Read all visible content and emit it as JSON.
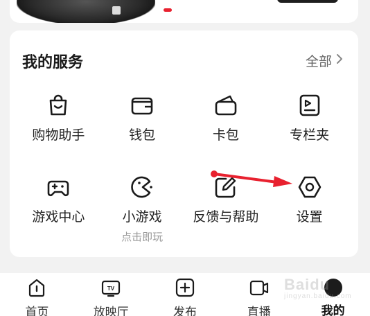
{
  "services": {
    "title": "我的服务",
    "all_label": "全部",
    "items": [
      {
        "label": "购物助手",
        "icon": "shopping-bag-icon"
      },
      {
        "label": "钱包",
        "icon": "wallet-icon"
      },
      {
        "label": "卡包",
        "icon": "card-holder-icon"
      },
      {
        "label": "专栏夹",
        "icon": "column-folder-icon"
      },
      {
        "label": "游戏中心",
        "icon": "gamepad-icon"
      },
      {
        "label": "小游戏",
        "sub": "点击即玩",
        "icon": "mini-game-icon"
      },
      {
        "label": "反馈与帮助",
        "icon": "feedback-edit-icon"
      },
      {
        "label": "设置",
        "icon": "settings-hexagon-icon"
      }
    ]
  },
  "annotation": {
    "color": "#e8212f"
  },
  "tabbar": {
    "items": [
      {
        "label": "首页",
        "icon": "home-icon"
      },
      {
        "label": "放映厅",
        "icon": "tv-icon"
      },
      {
        "label": "发布",
        "icon": "plus-icon"
      },
      {
        "label": "直播",
        "icon": "camera-icon"
      },
      {
        "label": "我的",
        "icon": "avatar-icon",
        "active": true
      }
    ]
  },
  "watermark": {
    "text": "Baidu",
    "sub": "jingyan.baidu.com"
  },
  "colors": {
    "accent": "#e8212f",
    "background": "#f2f2f2",
    "card": "#ffffff"
  }
}
